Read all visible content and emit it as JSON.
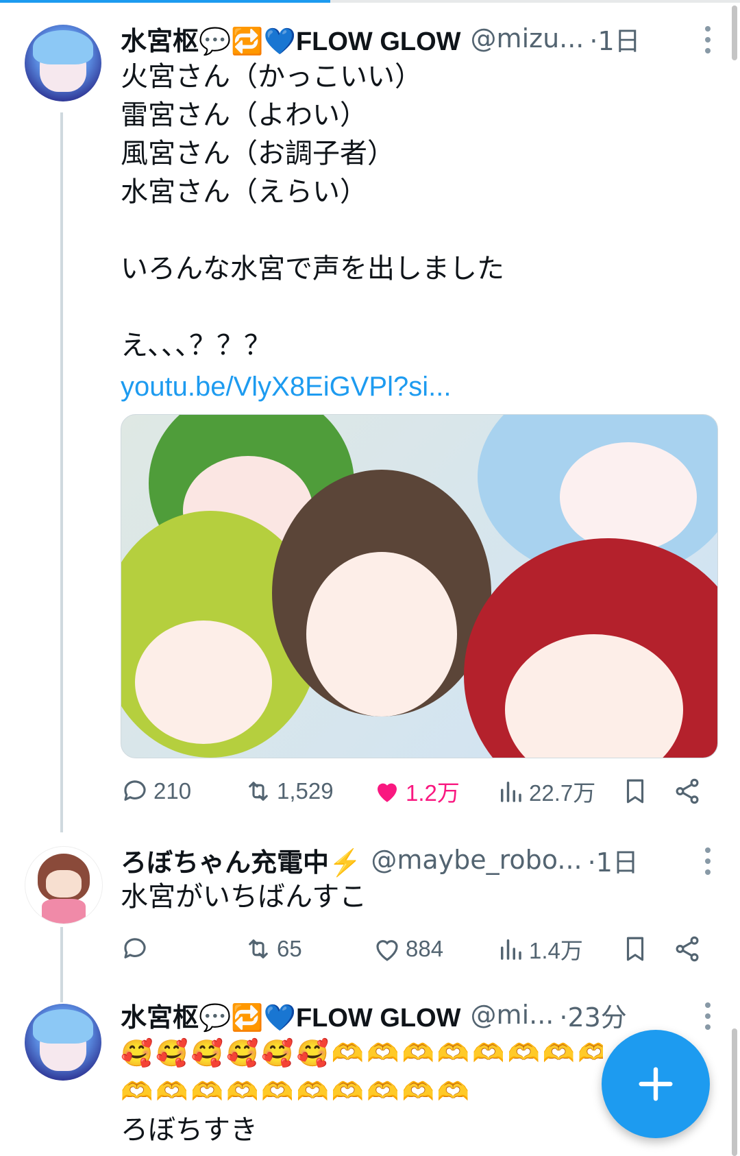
{
  "tweets": [
    {
      "display_name": "水宮枢💬🔁💙FLOW GLOW",
      "handle": "@mizu...",
      "time": "·1日",
      "lines": [
        "火宮さん（かっこいい）",
        "雷宮さん（よわい）",
        "風宮さん（お調子者）",
        "水宮さん（えらい）",
        "",
        "いろんな水宮で声を出しました",
        "",
        "え､､､？？？"
      ],
      "link": "youtu.be/VlyX8EiGVPl?si...",
      "counts": {
        "replies": "210",
        "retweets": "1,529",
        "likes": "1.2万",
        "views": "22.7万"
      }
    },
    {
      "display_name": "ろぼちゃん充電中⚡",
      "handle": "@maybe_robo...",
      "time": "·1日",
      "lines": [
        "水宮がいちばんすこ"
      ],
      "counts": {
        "replies": "",
        "retweets": "65",
        "likes": "884",
        "views": "1.4万"
      }
    },
    {
      "display_name": "水宮枢💬🔁💙FLOW GLOW",
      "handle": "@mi...",
      "time": "·23分",
      "lines": [
        "🥰🥰🥰🥰🥰🥰🫶🫶🫶🫶🫶🫶🫶🫶",
        "🫶🫶🫶🫶🫶🫶🫶🫶🫶🫶",
        "ろぼちすき"
      ]
    }
  ],
  "colors": {
    "accent": "#1d9bf0",
    "like": "#f91880",
    "muted": "#536471"
  },
  "icons": {
    "reply": "reply-icon",
    "retweet": "retweet-icon",
    "like": "heart-icon",
    "views": "views-icon",
    "bookmark": "bookmark-icon",
    "share": "share-icon",
    "compose": "plus-icon"
  }
}
